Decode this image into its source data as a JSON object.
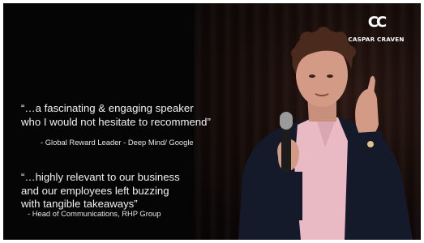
{
  "brand": {
    "mark": "CC",
    "name": "CASPAR CRAVEN"
  },
  "testimonials": [
    {
      "line1": "“…a fascinating & engaging speaker",
      "line2": "who I would not hesitate to recommend”",
      "attribution": "-  Global Reward Leader - Deep Mind/ Google"
    },
    {
      "line1": "“…highly relevant to our business",
      "line2": "and our employees left buzzing",
      "line3": "with tangible takeaways”",
      "attribution": "- Head of Communications, RHP Group"
    }
  ],
  "colors": {
    "background": "#050505",
    "text": "#f2f2f2",
    "shirt": "#e9b9c4",
    "jacket": "#141a2a"
  }
}
